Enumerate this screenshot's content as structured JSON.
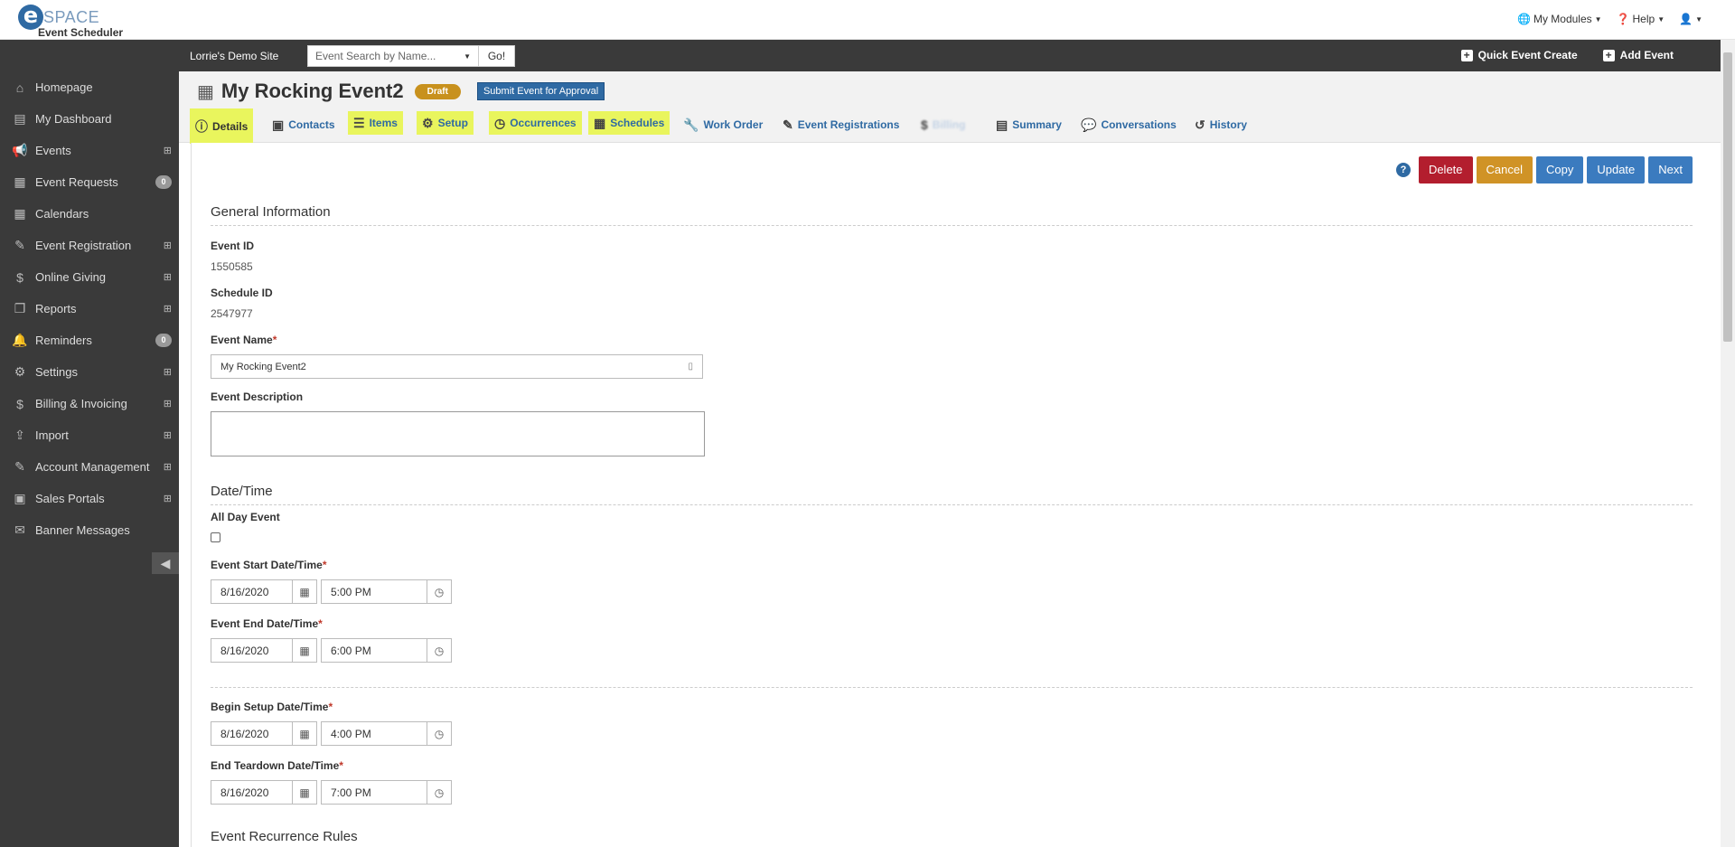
{
  "logo": {
    "letter": "e",
    "space": "SPACE",
    "subtitle": "Event Scheduler"
  },
  "top_nav": {
    "modules": "My Modules",
    "help": "Help"
  },
  "site_bar": {
    "site_name": "Lorrie's Demo Site",
    "search_placeholder": "Event Search by Name...",
    "go_label": "Go!",
    "quick_create": "Quick Event Create",
    "add_event": "Add Event"
  },
  "sidebar": {
    "items": [
      {
        "label": "Homepage",
        "icon": "home-icon",
        "glyph": "⌂"
      },
      {
        "label": "My Dashboard",
        "icon": "dashboard-icon",
        "glyph": "▤"
      },
      {
        "label": "Events",
        "icon": "megaphone-icon",
        "glyph": "📢"
      },
      {
        "label": "Event Requests",
        "icon": "calendar-icon",
        "glyph": "▦",
        "badge": "0"
      },
      {
        "label": "Calendars",
        "icon": "calendar-icon",
        "glyph": "▦"
      },
      {
        "label": "Event Registration",
        "icon": "ticket-icon",
        "glyph": "✎"
      },
      {
        "label": "Online Giving",
        "icon": "dollar-icon",
        "glyph": "$"
      },
      {
        "label": "Reports",
        "icon": "reports-icon",
        "glyph": "❐"
      },
      {
        "label": "Reminders",
        "icon": "bell-icon",
        "glyph": "🔔",
        "badge": "0"
      },
      {
        "label": "Settings",
        "icon": "gear-icon",
        "glyph": "⚙"
      },
      {
        "label": "Billing & Invoicing",
        "icon": "dollar-icon",
        "glyph": "$"
      },
      {
        "label": "Import",
        "icon": "upload-icon",
        "glyph": "⇪"
      },
      {
        "label": "Account Management",
        "icon": "pencil-icon",
        "glyph": "✎"
      },
      {
        "label": "Sales Portals",
        "icon": "money-icon",
        "glyph": "▣"
      },
      {
        "label": "Banner Messages",
        "icon": "envelope-icon",
        "glyph": "✉"
      }
    ]
  },
  "event": {
    "title": "My Rocking Event2",
    "status": "Draft",
    "submit_label": "Submit Event for Approval"
  },
  "tabs": [
    {
      "label": "Details"
    },
    {
      "label": "Contacts"
    },
    {
      "label": "Items"
    },
    {
      "label": "Setup"
    },
    {
      "label": "Occurrences"
    },
    {
      "label": "Schedules"
    },
    {
      "label": "Work Order"
    },
    {
      "label": "Event Registrations"
    },
    {
      "label": "Billing"
    },
    {
      "label": "Summary"
    },
    {
      "label": "Conversations"
    },
    {
      "label": "History"
    }
  ],
  "actions": {
    "help": "?",
    "delete": "Delete",
    "cancel": "Cancel",
    "copy": "Copy",
    "update": "Update",
    "next": "Next"
  },
  "general": {
    "title": "General Information",
    "event_id_label": "Event ID",
    "event_id": "1550585",
    "schedule_id_label": "Schedule ID",
    "schedule_id": "2547977",
    "event_name_label": "Event Name",
    "event_name": "My Rocking Event2",
    "description_label": "Event Description"
  },
  "datetime": {
    "title": "Date/Time",
    "all_day_label": "All Day Event",
    "start_label": "Event Start Date/Time",
    "start_date": "8/16/2020",
    "start_time": "5:00 PM",
    "end_label": "Event End Date/Time",
    "end_date": "8/16/2020",
    "end_time": "6:00 PM",
    "setup_label": "Begin Setup Date/Time",
    "setup_date": "8/16/2020",
    "setup_time": "4:00 PM",
    "teardown_label": "End Teardown Date/Time",
    "teardown_date": "8/16/2020",
    "teardown_time": "7:00 PM"
  },
  "recurrence": {
    "title": "Event Recurrence Rules"
  }
}
